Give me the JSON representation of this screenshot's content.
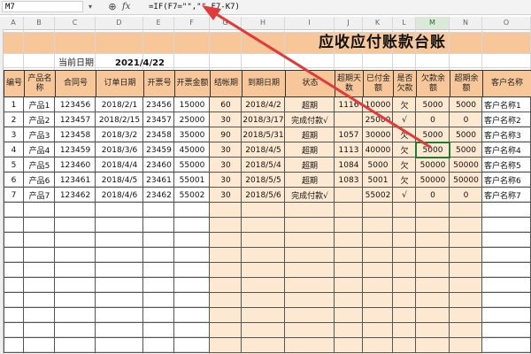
{
  "formula_bar": {
    "name_box": "M7",
    "zoom_icon": "zoom-icon",
    "fx_icon": "fx-icon",
    "fx_label": "fx",
    "formula": "=IF(F7=\"\",\"\",F7-K7)"
  },
  "columns": [
    "A",
    "B",
    "C",
    "D",
    "E",
    "F",
    "G",
    "H",
    "I",
    "J",
    "K",
    "L",
    "M",
    "N",
    "O"
  ],
  "selected_column": "M",
  "sheet": {
    "title": "应收应付账款台账",
    "date_label": "当前日期",
    "date_value": "2021/4/22",
    "headers": [
      "编号",
      "产品名称",
      "合同号",
      "订单日期",
      "开票号",
      "开票金额",
      "结帐期",
      "到期日期",
      "状态",
      "超期天数",
      "已付金额",
      "是否欠款",
      "欠款余额",
      "超期余额",
      "客户名称"
    ],
    "rows": [
      [
        "1",
        "产品1",
        "123456",
        "2018/2/1",
        "23456",
        "15000",
        "60",
        "2018/4/2",
        "超期",
        "1116",
        "10000",
        "欠",
        "5000",
        "5000",
        "客户名称1"
      ],
      [
        "2",
        "产品2",
        "123457",
        "2018/2/15",
        "23457",
        "25000",
        "30",
        "2018/3/17",
        "完成付款√",
        "",
        "25000",
        "√",
        "0",
        "0",
        "客户名称2"
      ],
      [
        "3",
        "产品3",
        "123458",
        "2018/3/2",
        "23458",
        "35000",
        "90",
        "2018/5/31",
        "超期",
        "1057",
        "30000",
        "欠",
        "5000",
        "5000",
        "客户名称3"
      ],
      [
        "4",
        "产品4",
        "123459",
        "2018/3/6",
        "23459",
        "45000",
        "30",
        "2018/4/5",
        "超期",
        "1113",
        "40000",
        "欠",
        "5000",
        "5000",
        "客户名称4"
      ],
      [
        "5",
        "产品5",
        "123460",
        "2018/4/4",
        "23460",
        "55000",
        "30",
        "2018/5/4",
        "超期",
        "1084",
        "5000",
        "欠",
        "50000",
        "50000",
        "客户名称5"
      ],
      [
        "6",
        "产品6",
        "123461",
        "2018/4/5",
        "23461",
        "55001",
        "30",
        "2018/5/5",
        "超期",
        "1083",
        "5001",
        "欠",
        "50000",
        "50000",
        "客户名称6"
      ],
      [
        "7",
        "产品7",
        "123462",
        "2018/4/6",
        "23462",
        "55002",
        "30",
        "2018/5/6",
        "完成付款√",
        "",
        "55002",
        "√",
        "0",
        "0",
        "客户名称7"
      ]
    ]
  },
  "colors": {
    "header_fill": "#f7c79a",
    "band_fill": "#fde9d1",
    "arrow": "#e03a3a",
    "selection": "#1e7d32"
  }
}
